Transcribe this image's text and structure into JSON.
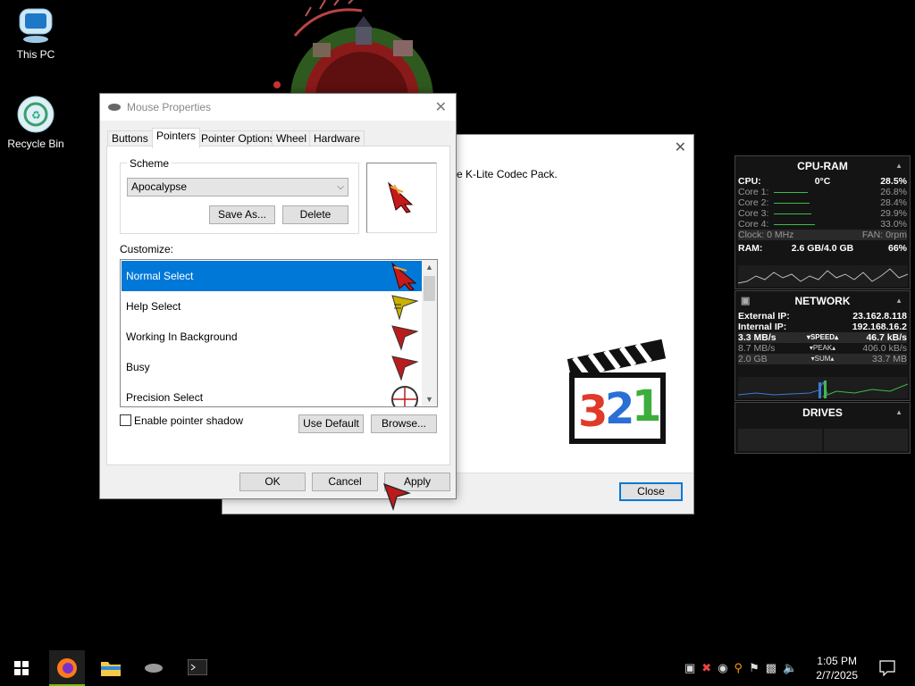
{
  "desktop": {
    "icons": [
      {
        "label": "This PC"
      },
      {
        "label": "Recycle Bin"
      }
    ]
  },
  "codec_window": {
    "message": "e K-Lite Codec Pack.",
    "close_button": "Close",
    "logo_digits": [
      "3",
      "2",
      "1"
    ]
  },
  "mouse_properties": {
    "title": "Mouse Properties",
    "tabs": [
      {
        "label": "Buttons"
      },
      {
        "label": "Pointers"
      },
      {
        "label": "Pointer Options"
      },
      {
        "label": "Wheel"
      },
      {
        "label": "Hardware"
      }
    ],
    "active_tab": "Pointers",
    "scheme": {
      "group_label": "Scheme",
      "selected": "Apocalypse",
      "save_as_label": "Save As...",
      "delete_label": "Delete"
    },
    "customize_label": "Customize:",
    "pointers": [
      {
        "label": "Normal Select",
        "selected": true
      },
      {
        "label": "Help Select",
        "selected": false
      },
      {
        "label": "Working In Background",
        "selected": false
      },
      {
        "label": "Busy",
        "selected": false
      },
      {
        "label": "Precision Select",
        "selected": false
      }
    ],
    "shadow_checkbox": {
      "label": "Enable pointer shadow",
      "checked": false
    },
    "use_default_label": "Use Default",
    "browse_label": "Browse...",
    "ok_label": "OK",
    "cancel_label": "Cancel",
    "apply_label": "Apply"
  },
  "gadget": {
    "cpu_ram": {
      "title": "CPU-RAM",
      "cpu_label": "CPU:",
      "cpu_temp": "0°C",
      "cpu_value": "28.5%",
      "cores": [
        {
          "label": "Core 1:",
          "value": "26.8%"
        },
        {
          "label": "Core 2:",
          "value": "28.4%"
        },
        {
          "label": "Core 3:",
          "value": "29.9%"
        },
        {
          "label": "Core 4:",
          "value": "33.0%"
        }
      ],
      "clock": "Clock: 0 MHz",
      "fan": "FAN: 0rpm",
      "ram_label": "RAM:",
      "ram_value": "2.6 GB/4.0 GB",
      "ram_percent": "66%"
    },
    "network": {
      "title": "NETWORK",
      "external_ip_label": "External IP:",
      "external_ip": "23.162.8.118",
      "internal_ip_label": "Internal IP:",
      "internal_ip": "192.168.16.2",
      "speed_left": "3.3 MB/s",
      "speed_label": "SPEED",
      "speed_right": "46.7 kB/s",
      "peak_left": "8.7 MB/s",
      "peak_label": "PEAK",
      "peak_right": "406.0 kB/s",
      "sum_left": "2.0 GB",
      "sum_label": "SUM",
      "sum_right": "33.7 MB"
    },
    "drives": {
      "title": "DRIVES"
    }
  },
  "taskbar": {
    "time": "1:05 PM",
    "date": "2/7/2025"
  },
  "colors": {
    "selection": "#0078d7",
    "gadget_bg": "#141414",
    "graph_green": "#3fb94f"
  }
}
